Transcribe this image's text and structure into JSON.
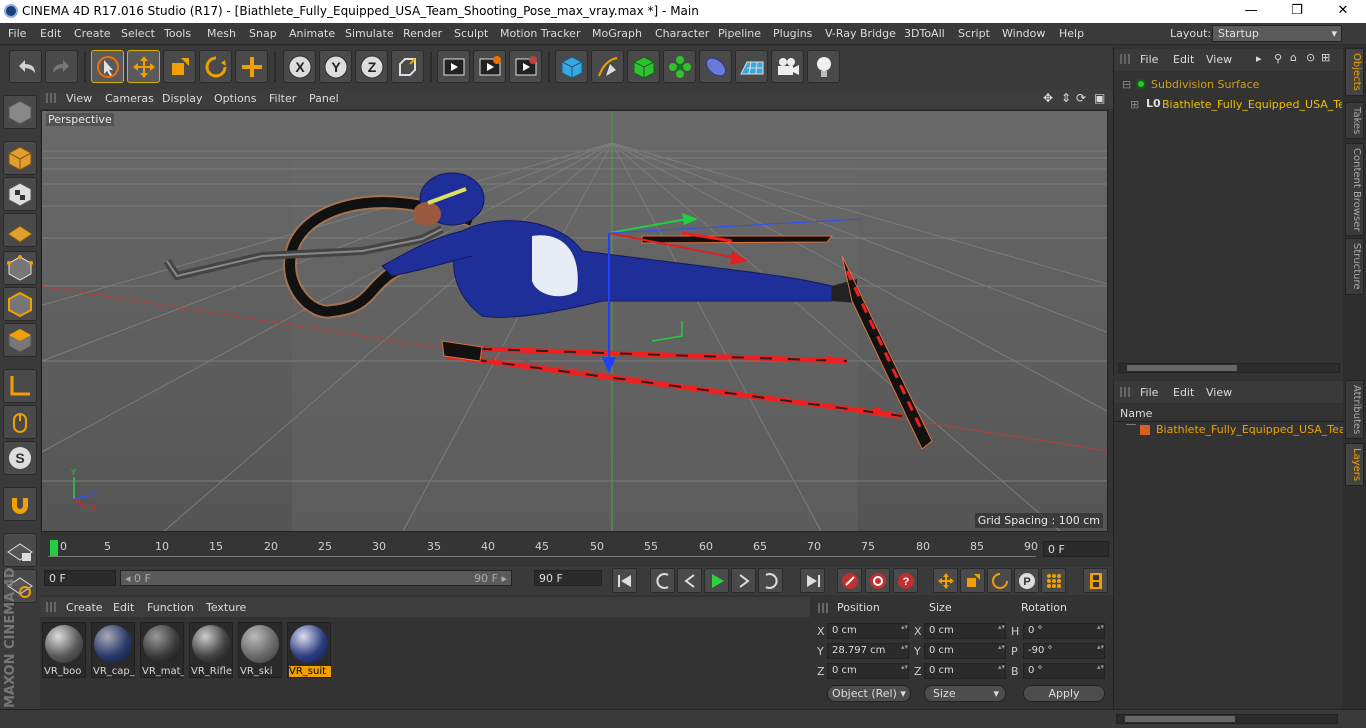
{
  "window": {
    "title": "CINEMA 4D R17.016 Studio (R17) - [Biathlete_Fully_Equipped_USA_Team_Shooting_Pose_max_vray.max *] - Main",
    "minimize": "—",
    "maximize": "❐",
    "close": "✕"
  },
  "menubar": {
    "items": [
      "File",
      "Edit",
      "Create",
      "Select",
      "Tools",
      "Mesh",
      "Snap",
      "Animate",
      "Simulate",
      "Render",
      "Sculpt",
      "Motion Tracker",
      "MoGraph",
      "Character",
      "Pipeline",
      "Plugins",
      "V-Ray Bridge",
      "3DToAll",
      "Script",
      "Window",
      "Help"
    ],
    "layout_label": "Layout:",
    "layout_value": "Startup"
  },
  "toolbar": {
    "icons": [
      "undo-icon",
      "redo-icon",
      "select-icon",
      "move-icon",
      "scale-icon",
      "rotate-icon",
      "add-icon",
      "x-axis-icon",
      "y-axis-icon",
      "z-axis-icon",
      "world-coord-icon",
      "render-view-icon",
      "render-picture-viewer-icon",
      "render-settings-icon",
      "cube-icon",
      "pen-icon",
      "subdivision-icon",
      "mograph-cloner-icon",
      "deformer-icon",
      "floor-icon",
      "camera-icon",
      "light-icon"
    ],
    "axis_labels": [
      "X",
      "Y",
      "Z"
    ]
  },
  "viewport": {
    "menu": [
      "View",
      "Cameras",
      "Display",
      "Options",
      "Filter",
      "Panel"
    ],
    "label": "Perspective",
    "grid_spacing": "Grid Spacing : 100 cm",
    "axis_x": "X",
    "axis_y": "Y",
    "axis_z": "Z"
  },
  "timeline": {
    "ticks": [
      "0",
      "5",
      "10",
      "15",
      "20",
      "25",
      "30",
      "35",
      "40",
      "45",
      "50",
      "55",
      "60",
      "65",
      "70",
      "75",
      "80",
      "85",
      "90"
    ],
    "current_frame": "0 F"
  },
  "transport": {
    "start": "0 F",
    "slider_start": "◂ 0 F",
    "slider_end": "90 F ▸",
    "end": "90 F"
  },
  "materials": {
    "menu": [
      "Create",
      "Edit",
      "Function",
      "Texture"
    ],
    "items": [
      {
        "name": "VR_boo",
        "color": "#5a5a5a"
      },
      {
        "name": "VR_cap_",
        "color": "#2a3a6a"
      },
      {
        "name": "VR_mat_",
        "color": "#3a3a3a"
      },
      {
        "name": "VR_Rifle",
        "color": "#444444"
      },
      {
        "name": "VR_ski",
        "color": "#6a6a6a"
      },
      {
        "name": "VR_suit",
        "color": "#2c3f82"
      }
    ]
  },
  "coords": {
    "headers": [
      "Position",
      "Size",
      "Rotation"
    ],
    "rows": [
      {
        "axis": "X",
        "pos": "0 cm",
        "saxis": "X",
        "size": "0 cm",
        "raxis": "H",
        "rot": "0 °"
      },
      {
        "axis": "Y",
        "pos": "28.797 cm",
        "saxis": "Y",
        "size": "0 cm",
        "raxis": "P",
        "rot": "-90 °"
      },
      {
        "axis": "Z",
        "pos": "0 cm",
        "saxis": "Z",
        "size": "0 cm",
        "raxis": "B",
        "rot": "0 °"
      }
    ],
    "mode": "Object (Rel)",
    "size_mode": "Size",
    "apply": "Apply"
  },
  "objects": {
    "menu": [
      "File",
      "Edit",
      "View"
    ],
    "items": [
      "Subdivision Surface",
      "Biathlete_Fully_Equipped_USA_Team"
    ]
  },
  "layers": {
    "menu": [
      "File",
      "Edit",
      "View"
    ],
    "column": "Name",
    "items": [
      "Biathlete_Fully_Equipped_USA_Team"
    ]
  },
  "sidetabs": [
    "Objects",
    "Takes",
    "Content Browser",
    "Structure",
    "Attributes",
    "Layers"
  ],
  "colors": {
    "accent": "#f0a000",
    "selection": "#d8b000",
    "x_axis": "#e03020",
    "y_axis": "#20d040",
    "z_axis": "#3050ff"
  }
}
